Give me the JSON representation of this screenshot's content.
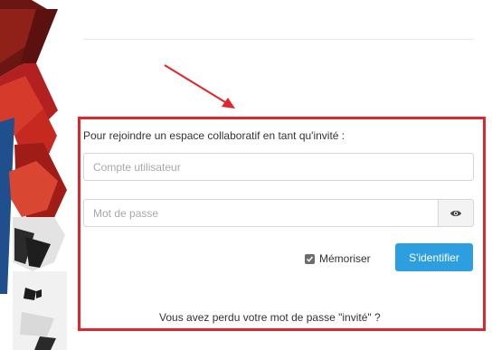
{
  "guest_login": {
    "intro": "Pour rejoindre un espace collaboratif en tant qu'invité :",
    "username_placeholder": "Compte utilisateur",
    "password_placeholder": "Mot de passe",
    "remember_label": "Mémoriser",
    "remember_checked": true,
    "submit_label": "S'identifier",
    "forgot_link": "Vous avez perdu votre mot de passe \"invité\" ?"
  },
  "icons": {
    "show_password": "eye-icon",
    "remember_check": "checkmark-icon",
    "annotation_arrow": "arrow-icon"
  },
  "colors": {
    "highlight_border": "#e0252b",
    "button": "#2d9fe0",
    "side_blue": "#1f4f8c",
    "side_red": "#b32020"
  }
}
